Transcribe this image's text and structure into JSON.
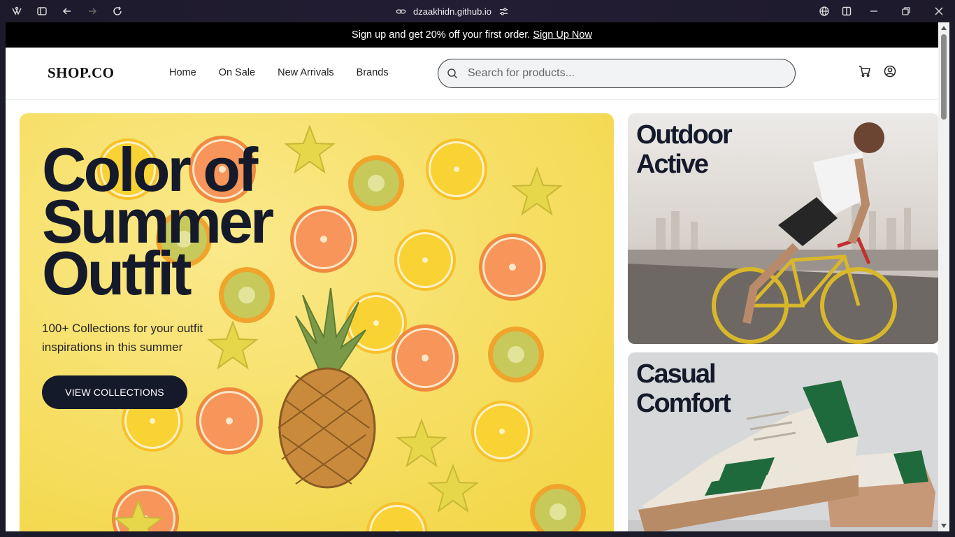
{
  "browser": {
    "url": "dzaakhidn.github.io"
  },
  "promo": {
    "text": "Sign up and get 20% off your first order.",
    "link": "Sign Up Now"
  },
  "header": {
    "logo": "SHOP.CO",
    "nav": [
      "Home",
      "On Sale",
      "New Arrivals",
      "Brands"
    ],
    "search_placeholder": "Search for products..."
  },
  "hero": {
    "title": "Color of Summer Outfit",
    "subtitle": "100+ Collections for your outfit inspirations in this summer",
    "button": "VIEW COLLECTIONS"
  },
  "categories": [
    {
      "title": "Outdoor Active"
    },
    {
      "title": "Casual Comfort"
    }
  ],
  "colors": {
    "primary": "#151a2b",
    "hero_background": "#f7df63",
    "promo_background": "#000000"
  },
  "icons": [
    "extension-icon",
    "sidebar-icon",
    "back-icon",
    "forward-icon",
    "reload-icon",
    "link-icon",
    "site-settings-icon",
    "globe-icon",
    "split-view-icon",
    "minimize-icon",
    "restore-icon",
    "close-icon",
    "search-icon",
    "cart-icon",
    "user-icon"
  ]
}
